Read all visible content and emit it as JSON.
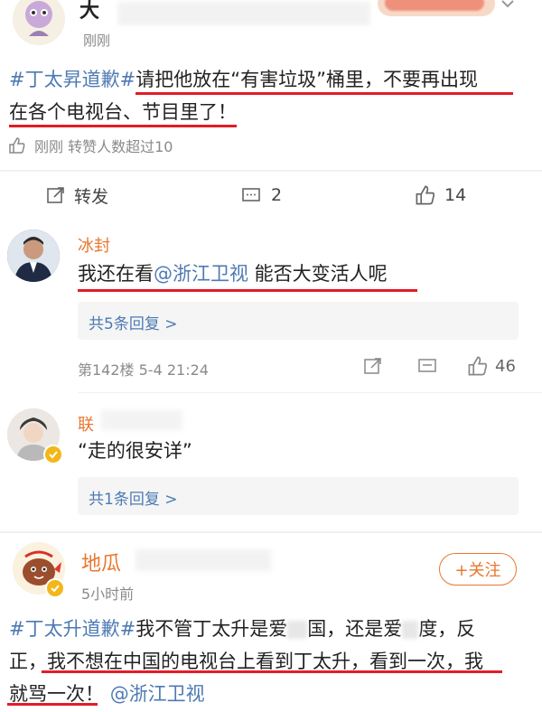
{
  "post1": {
    "username": "大",
    "time": "刚刚",
    "hashtag": "#丁太昇道歉#",
    "text_line1_rest": "请把他放在“有害垃圾”桶里，不要再出现",
    "text_line2": "在各个电视台、节目里了！",
    "like_meta": "刚刚 转赞人数超过10",
    "actions": {
      "repost_label": "转发",
      "comment_count": "2",
      "like_count": "14"
    }
  },
  "comment1": {
    "username": "冰封",
    "text_prefix": "我还在看",
    "mention": "@浙江卫视",
    "text_suffix": " 能否大变活人呢",
    "replies": "共5条回复 >",
    "floor_meta": "第142楼 5-4 21:24",
    "like_count": "46"
  },
  "comment2": {
    "username": "联",
    "text": "“走的很安详”",
    "replies": "共1条回复 >"
  },
  "post2": {
    "username": "地瓜",
    "time": "5小时前",
    "follow_label": "+关注",
    "hashtag": "#丁太升道歉#",
    "line1_rest": "我不管丁太升是爱",
    "line1_b": "国，还是爱",
    "line1_c": "度，反",
    "line2": "正，我不想在中国的电视台上看到丁太升，看到一次，我",
    "line3_a": "就骂一次！",
    "mention": "@浙江卫视"
  },
  "colors": {
    "accent_orange": "#e8772f",
    "link_blue": "#4d7ab3",
    "underline_red": "#e31c25",
    "meta_gray": "#8a8a8a"
  }
}
